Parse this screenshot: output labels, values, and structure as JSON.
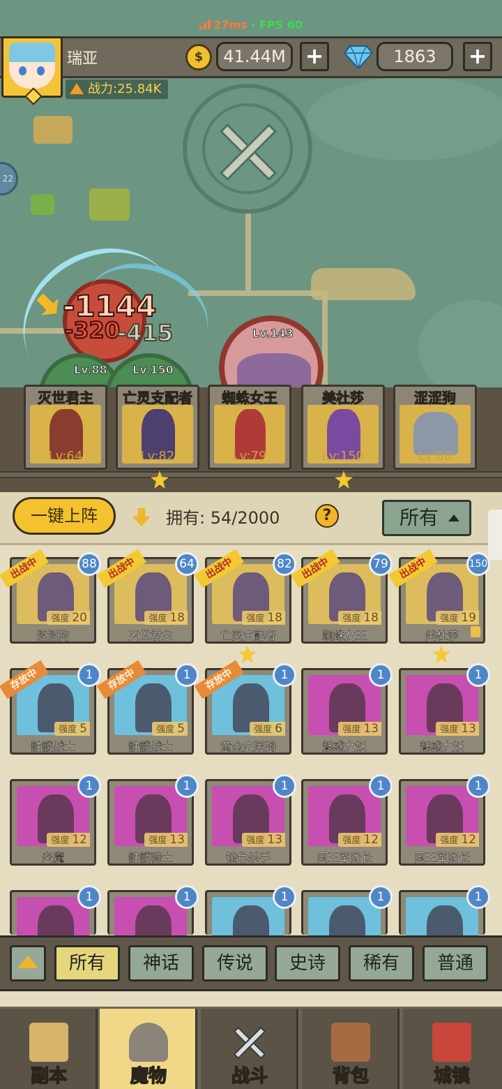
{
  "perf": {
    "latency": "27ms",
    "separator": "·",
    "fps": "FPS 60"
  },
  "player": {
    "name": "瑞亚",
    "power": "战力:25.84K"
  },
  "resources": {
    "gold": "41.44M",
    "gems": "1863",
    "plus": "+"
  },
  "map": {
    "left_badge": "22"
  },
  "battle": {
    "damage_main": "-1144",
    "damage_2": "-320",
    "damage_3": "-415",
    "ally_levels": [
      "Lv.88",
      "Lv.150"
    ],
    "boss_level": "Lv.143"
  },
  "lineup": [
    {
      "name": "灭世君主",
      "level": "Lv:64",
      "starred": false
    },
    {
      "name": "亡灵支配者",
      "level": "Lv:82",
      "starred": true
    },
    {
      "name": "蜘蛛女王",
      "level": "Lv:79",
      "starred": false
    },
    {
      "name": "美杜莎",
      "level": "Lv:150",
      "starred": true
    },
    {
      "name": "涩涩狗",
      "level": "Lv:88",
      "starred": false
    }
  ],
  "controls": {
    "deploy_label": "一键上阵",
    "own_label": "拥有:",
    "own_count": "54/2000",
    "help": "?",
    "filter_label": "所有"
  },
  "collection": [
    {
      "name": "涩涩狗",
      "strength_label": "强度",
      "strength": "20",
      "count": "88",
      "tag": "出战中",
      "bg": "gold",
      "starred": false
    },
    {
      "name": "灭世君主",
      "strength_label": "强度",
      "strength": "18",
      "count": "64",
      "tag": "出战中",
      "bg": "gold",
      "starred": false
    },
    {
      "name": "亡灵支配者",
      "strength_label": "强度",
      "strength": "18",
      "count": "82",
      "tag": "出战中",
      "bg": "gold",
      "starred": true
    },
    {
      "name": "蜘蛛女王",
      "strength_label": "强度",
      "strength": "18",
      "count": "79",
      "tag": "出战中",
      "bg": "gold",
      "starred": false
    },
    {
      "name": "美杜莎",
      "strength_label": "强度",
      "strength": "19",
      "count": "150",
      "tag": "出战中",
      "bg": "gold",
      "starred": true
    },
    {
      "name": "骷髅战士",
      "strength_label": "强度",
      "strength": "5",
      "count": "1",
      "tag": "存放中",
      "bg": "blue",
      "starred": false
    },
    {
      "name": "骷髅战士",
      "strength_label": "强度",
      "strength": "5",
      "count": "1",
      "tag": "存放中",
      "bg": "blue",
      "starred": false
    },
    {
      "name": "黄金史莱姆",
      "strength_label": "强度",
      "strength": "6",
      "count": "1",
      "tag": "存放中",
      "bg": "blue",
      "starred": false
    },
    {
      "name": "魅惑女妖",
      "strength_label": "强度",
      "strength": "13",
      "count": "1",
      "tag": "",
      "bg": "purple",
      "starred": false
    },
    {
      "name": "魅惑女妖",
      "strength_label": "强度",
      "strength": "13",
      "count": "1",
      "tag": "",
      "bg": "purple",
      "starred": false
    },
    {
      "name": "炎魔",
      "strength_label": "强度",
      "strength": "12",
      "count": "1",
      "tag": "",
      "bg": "purple",
      "starred": false
    },
    {
      "name": "骷髅骑士",
      "strength_label": "强度",
      "strength": "13",
      "count": "1",
      "tag": "",
      "bg": "purple",
      "starred": false
    },
    {
      "name": "银色杀手",
      "strength_label": "强度",
      "strength": "13",
      "count": "1",
      "tag": "",
      "bg": "purple",
      "starred": false
    },
    {
      "name": "国王军团长",
      "strength_label": "强度",
      "strength": "12",
      "count": "1",
      "tag": "",
      "bg": "purple",
      "starred": false
    },
    {
      "name": "国王军团长",
      "strength_label": "强度",
      "strength": "12",
      "count": "1",
      "tag": "",
      "bg": "purple",
      "starred": false
    },
    {
      "name": "",
      "strength_label": "",
      "strength": "",
      "count": "1",
      "tag": "",
      "bg": "purple",
      "starred": false
    },
    {
      "name": "",
      "strength_label": "",
      "strength": "",
      "count": "1",
      "tag": "",
      "bg": "purple",
      "starred": false
    },
    {
      "name": "",
      "strength_label": "",
      "strength": "",
      "count": "1",
      "tag": "",
      "bg": "blue",
      "starred": false
    },
    {
      "name": "",
      "strength_label": "",
      "strength": "",
      "count": "1",
      "tag": "",
      "bg": "blue",
      "starred": false
    },
    {
      "name": "",
      "strength_label": "",
      "strength": "",
      "count": "1",
      "tag": "",
      "bg": "blue",
      "starred": false
    }
  ],
  "rarity_filters": [
    "所有",
    "神话",
    "传说",
    "史诗",
    "稀有",
    "普通"
  ],
  "nav": [
    {
      "label": "副本",
      "icon": "map-icon",
      "active": false
    },
    {
      "label": "魔物",
      "icon": "helmet-icon",
      "active": true
    },
    {
      "label": "战斗",
      "icon": "crossed-swords-icon",
      "active": false
    },
    {
      "label": "背包",
      "icon": "backpack-icon",
      "active": false
    },
    {
      "label": "城镇",
      "icon": "shop-icon",
      "active": false
    }
  ],
  "colors": {
    "map_bg": "#6c9582",
    "accent_yellow": "#f4c22e",
    "count_badge": "#4f86c7",
    "tag_out": "#f4c833",
    "tag_store": "#e98a3a"
  }
}
